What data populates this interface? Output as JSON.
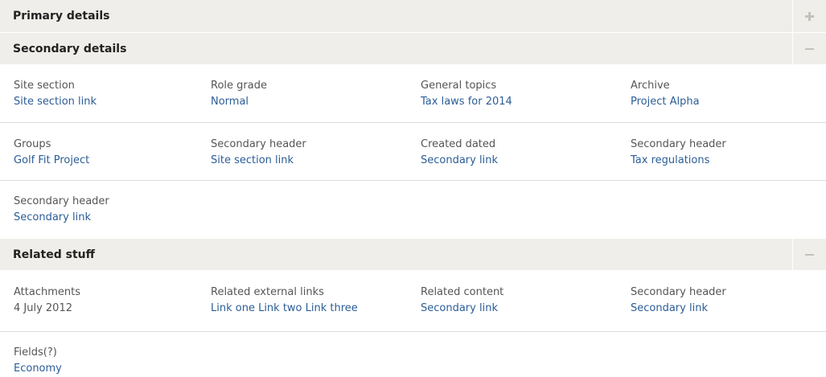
{
  "sections": {
    "primary": {
      "title": "Primary details",
      "toggle_icon": "plus-icon"
    },
    "secondary": {
      "title": "Secondary details",
      "toggle_icon": "minus-icon",
      "rows": [
        [
          {
            "label": "Site section",
            "value": "Site section link"
          },
          {
            "label": "Role grade",
            "value": "Normal"
          },
          {
            "label": "General topics",
            "value": "Tax laws for 2014"
          },
          {
            "label": "Archive",
            "value": "Project Alpha"
          }
        ],
        [
          {
            "label": "Groups",
            "value": "Golf Fit Project"
          },
          {
            "label": "Secondary header",
            "value": "Site section link"
          },
          {
            "label": "Created dated",
            "value": "Secondary link"
          },
          {
            "label": "Secondary header",
            "value": "Tax regulations"
          }
        ],
        [
          {
            "label": "Secondary header",
            "value": "Secondary link"
          }
        ]
      ]
    },
    "related": {
      "title": "Related stuff",
      "toggle_icon": "minus-icon",
      "rows": [
        [
          {
            "label": "Attachments",
            "value": "4 July 2012"
          },
          {
            "label": "Related external links",
            "value": "Link one Link two Link three"
          },
          {
            "label": "Related content",
            "value": "Secondary link"
          },
          {
            "label": "Secondary header",
            "value": "Secondary link"
          }
        ],
        [
          {
            "label": "Fields(?)",
            "value": "Economy"
          }
        ]
      ]
    }
  },
  "colors": {
    "header_bg": "#efeeea",
    "link": "#2b5d96",
    "label": "#555555",
    "divider": "#dddddd"
  }
}
